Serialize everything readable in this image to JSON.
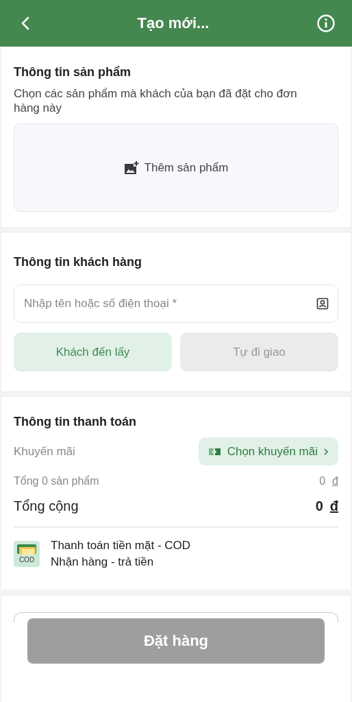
{
  "header": {
    "title": "Tạo mới..."
  },
  "product_section": {
    "title": "Thông tin sản phẩm",
    "description": "Chọn các sản phẩm mà khách của bạn đã đặt cho đơn hàng này",
    "add_label": "Thêm sản phẩm"
  },
  "customer_section": {
    "title": "Thông tin khách hàng",
    "search": {
      "placeholder": "Nhập tên hoặc số điện thoại *"
    },
    "delivery_options": [
      {
        "label": "Khách đến lấy",
        "selected": true
      },
      {
        "label": "Tự đi giao",
        "selected": false
      }
    ]
  },
  "payment_section": {
    "title": "Thông tin thanh toán",
    "promo_label": "Khuyến mãi",
    "promo_button": "Chọn khuyến mãi",
    "subtotal": {
      "label": "Tổng 0 sản phẩm",
      "amount": "0",
      "currency": "đ"
    },
    "total": {
      "label": "Tổng cộng",
      "amount": "0",
      "currency": "đ"
    },
    "method": {
      "icon_label": "COD",
      "title": "Thanh toán tiền mặt - COD",
      "subtitle": "Nhận hàng - trả tiền"
    }
  },
  "order_button": {
    "label": "Đặt hàng",
    "disabled": true
  }
}
